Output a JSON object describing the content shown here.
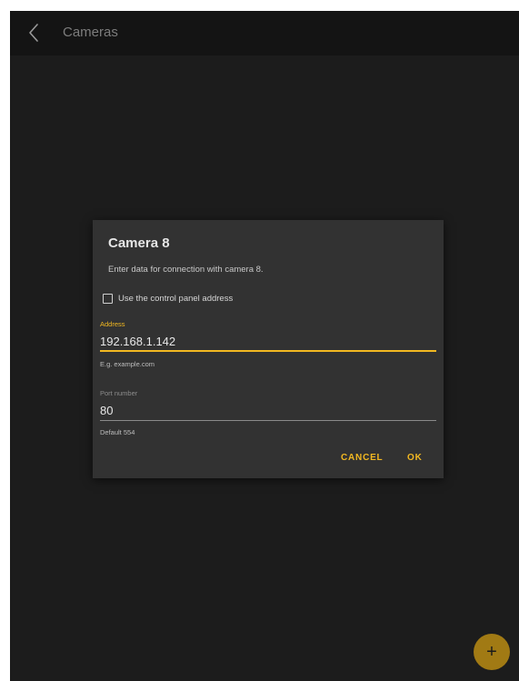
{
  "app_bar": {
    "title": "Cameras",
    "back_icon": "chevron-left-icon"
  },
  "dialog": {
    "title": "Camera 8",
    "message": "Enter data for connection with camera 8.",
    "checkbox_label": "Use the control panel address",
    "checkbox_checked": false,
    "address": {
      "label": "Address",
      "value": "192.168.1.142",
      "helper": "E.g. example.com"
    },
    "port": {
      "label": "Port number",
      "value": "80",
      "helper": "Default 554"
    },
    "cancel_label": "CANCEL",
    "ok_label": "OK"
  },
  "fab": {
    "label": "+",
    "icon": "plus-icon"
  },
  "colors": {
    "accent": "#f2b821",
    "background": "#1c1c1c",
    "app_bar": "#141414",
    "dialog": "#323232",
    "fab": "#a17a14"
  }
}
